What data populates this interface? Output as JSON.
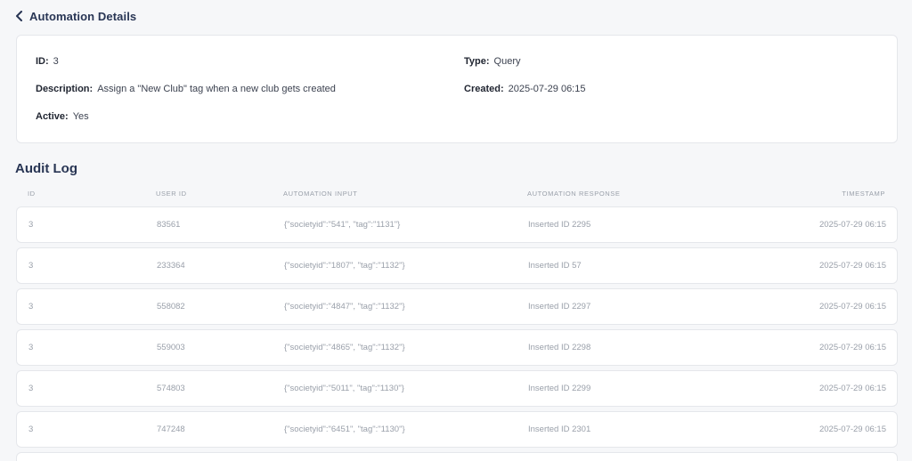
{
  "header": {
    "title": "Automation Details",
    "back_icon": "chevron-left-icon"
  },
  "details": {
    "id_label": "ID:",
    "id_value": "3",
    "description_label": "Description:",
    "description_value": "Assign a \"New Club\" tag when a new club gets created",
    "active_label": "Active:",
    "active_value": "Yes",
    "type_label": "Type:",
    "type_value": "Query",
    "created_label": "Created:",
    "created_value": "2025-07-29 06:15"
  },
  "audit_log": {
    "title": "Audit Log",
    "columns": {
      "id": "ID",
      "user_id": "USER ID",
      "input": "AUTOMATION INPUT",
      "response": "AUTOMATION RESPONSE",
      "timestamp": "TIMESTAMP"
    },
    "rows": [
      {
        "id": "3",
        "user_id": "83561",
        "input": "{\"societyid\":\"541\", \"tag\":\"1131\"}",
        "response": "Inserted ID 2295",
        "timestamp": "2025-07-29 06:15"
      },
      {
        "id": "3",
        "user_id": "233364",
        "input": "{\"societyid\":\"1807\", \"tag\":\"1132\"}",
        "response": "Inserted ID 57",
        "timestamp": "2025-07-29 06:15"
      },
      {
        "id": "3",
        "user_id": "558082",
        "input": "{\"societyid\":\"4847\", \"tag\":\"1132\"}",
        "response": "Inserted ID 2297",
        "timestamp": "2025-07-29 06:15"
      },
      {
        "id": "3",
        "user_id": "559003",
        "input": "{\"societyid\":\"4865\", \"tag\":\"1132\"}",
        "response": "Inserted ID 2298",
        "timestamp": "2025-07-29 06:15"
      },
      {
        "id": "3",
        "user_id": "574803",
        "input": "{\"societyid\":\"5011\", \"tag\":\"1130\"}",
        "response": "Inserted ID 2299",
        "timestamp": "2025-07-29 06:15"
      },
      {
        "id": "3",
        "user_id": "747248",
        "input": "{\"societyid\":\"6451\", \"tag\":\"1130\"}",
        "response": "Inserted ID 2301",
        "timestamp": "2025-07-29 06:15"
      }
    ]
  },
  "colors": {
    "heading": "#283554",
    "muted_text": "#9aa0aa",
    "card_background": "#ffffff",
    "page_background": "#f6f7f9",
    "border": "#e5e7eb"
  }
}
